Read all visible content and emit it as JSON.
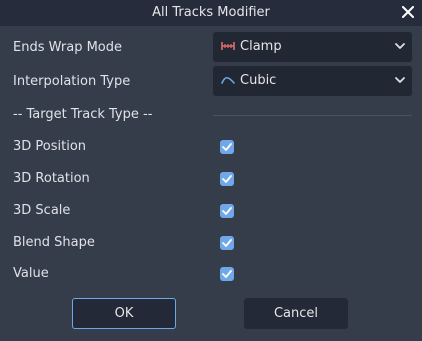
{
  "dialog": {
    "title": "All Tracks Modifier",
    "close_icon": "close-icon"
  },
  "fields": {
    "ends_wrap_mode": {
      "label": "Ends Wrap Mode",
      "value": "Clamp",
      "icon": "clamp-icon"
    },
    "interpolation_type": {
      "label": "Interpolation Type",
      "value": "Cubic",
      "icon": "cubic-curve-icon"
    }
  },
  "section_header": "-- Target Track Type --",
  "track_types": [
    {
      "label": "3D Position",
      "checked": true
    },
    {
      "label": "3D Rotation",
      "checked": true
    },
    {
      "label": "3D Scale",
      "checked": true
    },
    {
      "label": "Blend Shape",
      "checked": true
    },
    {
      "label": "Value",
      "checked": true
    }
  ],
  "buttons": {
    "ok": "OK",
    "cancel": "Cancel"
  },
  "colors": {
    "accent": "#6fa8e8",
    "clamp_icon": "#e06c6c",
    "background": "#363d4a",
    "titlebar": "#262c3b",
    "field_bg": "#222734"
  }
}
